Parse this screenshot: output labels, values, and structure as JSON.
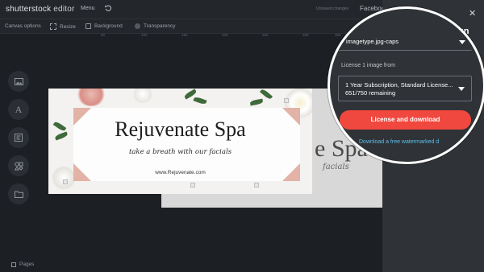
{
  "app": {
    "logo_main": "shutterstock",
    "logo_sub": " editor",
    "menu_label": "Menu",
    "top_small_text": "Unsaved changes",
    "top_right_text": "Facebook"
  },
  "toolbar": {
    "canvas_options": "Canvas options",
    "resize": "Resize",
    "background": "Background",
    "transparency": "Transparency"
  },
  "ruler": [
    "50",
    "100",
    "150",
    "200",
    "250",
    "300",
    "350",
    "400"
  ],
  "rail": {
    "items": [
      "image-icon",
      "text-icon",
      "template-icon",
      "elements-icon",
      "folder-icon"
    ],
    "text_glyph": "A",
    "pages_label": "Pages"
  },
  "canvas": {
    "title": "Rejuvenate Spa",
    "subtitle": "take a breath with our facials",
    "url": "www.Rejuvenate.com",
    "ghost_title": "e Spa",
    "ghost_subtitle": "facials"
  },
  "panel": {
    "heading": "gn",
    "file_type": "imagetype.jpg-caps",
    "license_label": "License 1 image from",
    "license_line1": "1 Year Subscription, Standard License...",
    "license_line2": "651/750 remaining",
    "download_button": "License and download",
    "watermark_link": "Download a free watermarked d"
  },
  "colors": {
    "accent_button": "#f0483e",
    "link": "#5bc0e8",
    "panel_bg": "#2f3237",
    "app_bg": "#1c1f24"
  }
}
